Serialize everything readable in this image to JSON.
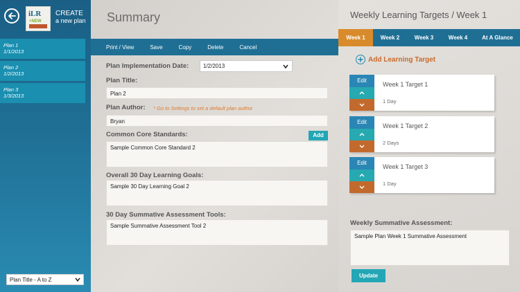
{
  "sidebar": {
    "logo_text": "iLR",
    "logo_badge": "+NEW",
    "create_line1": "CREATE",
    "create_line2": "a new plan",
    "plans": [
      {
        "name": "Plan 1",
        "date": "1/1/2013"
      },
      {
        "name": "Plan 2",
        "date": "1/2/2013"
      },
      {
        "name": "Plan 3",
        "date": "1/3/2013"
      }
    ],
    "sort_value": "Plan Title - A to Z"
  },
  "summary": {
    "title": "Summary",
    "toolbar": {
      "print": "Print / View",
      "save": "Save",
      "copy": "Copy",
      "delete": "Delete",
      "cancel": "Cancel"
    },
    "impl_date_label": "Plan Implementation Date:",
    "impl_date_value": "1/2/2013",
    "plan_title_label": "Plan Title:",
    "plan_title_value": "Plan 2",
    "author_label": "Plan Author:",
    "author_note": "* Go to Settings to set a default plan author",
    "author_value": "Bryan",
    "ccs_label": "Common Core Standards:",
    "ccs_add": "Add",
    "ccs_value": "Sample Common Core Standard 2",
    "goals_label": "Overall 30 Day Learning Goals:",
    "goals_value": "Sample 30 Day Learning Goal 2",
    "tools_label": "30 Day Summative Assessment Tools:",
    "tools_value": "Sample Summative Assessment Tool 2"
  },
  "weekly": {
    "title": "Weekly Learning Targets / Week 1",
    "tabs": [
      "Week 1",
      "Week 2",
      "Week 3",
      "Week 4",
      "At A Glance"
    ],
    "active_tab": 0,
    "add_target": "Add Learning Target",
    "edit_label": "Edit",
    "targets": [
      {
        "name": "Week 1 Target 1",
        "days": "1 Day"
      },
      {
        "name": "Week 1 Target 2",
        "days": "2 Days"
      },
      {
        "name": "Week 1 Target 3",
        "days": "1 Day"
      }
    ],
    "assessment_label": "Weekly Summative Assessment:",
    "assessment_value": "Sample Plan Week 1 Summative Assessment",
    "update_label": "Update"
  },
  "colors": {
    "sidebar_blue": "#1f6f95",
    "plan_item": "#1a8fb0",
    "accent_orange": "#d98b2b",
    "teal": "#23a6b5",
    "down_orange": "#c26a2d"
  },
  "icons": {
    "back": "arrow-left-icon",
    "chevron": "chevron-down-icon",
    "plus": "plus-circle-icon",
    "up": "chevron-up-icon"
  }
}
